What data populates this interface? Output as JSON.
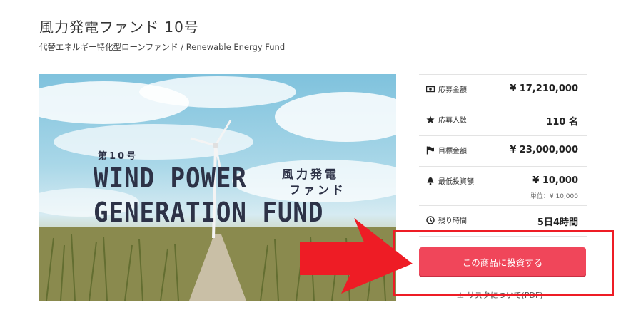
{
  "header": {
    "title": "風力発電ファンド 10号",
    "subtitle": "代替エネルギー特化型ローンファンド / Renewable Energy Fund"
  },
  "hero": {
    "number_label": "第10号",
    "english_line1": "WIND POWER",
    "english_line2": "GENERATION FUND",
    "japanese_line1": "風力発電",
    "japanese_line2": "ファンド"
  },
  "stats": [
    {
      "icon": "money-icon",
      "label": "応募金額",
      "value": "¥ 17,210,000"
    },
    {
      "icon": "star-icon",
      "label": "応募人数",
      "value": "110 名"
    },
    {
      "icon": "flag-icon",
      "label": "目標金額",
      "value": "¥ 23,000,000"
    },
    {
      "icon": "bell-icon",
      "label": "最低投資額",
      "value": "¥ 10,000",
      "sub": "単位：¥ 10,000"
    },
    {
      "icon": "clock-icon",
      "label": "残り時間",
      "value": "5日4時間"
    }
  ],
  "actions": {
    "invest_label": "この商品に投資する",
    "risk_label": "リスクについて(PDF)"
  },
  "colors": {
    "invest_button": "#f0465a",
    "annotation_red": "#ee1c25",
    "hero_text": "#2d3247"
  }
}
